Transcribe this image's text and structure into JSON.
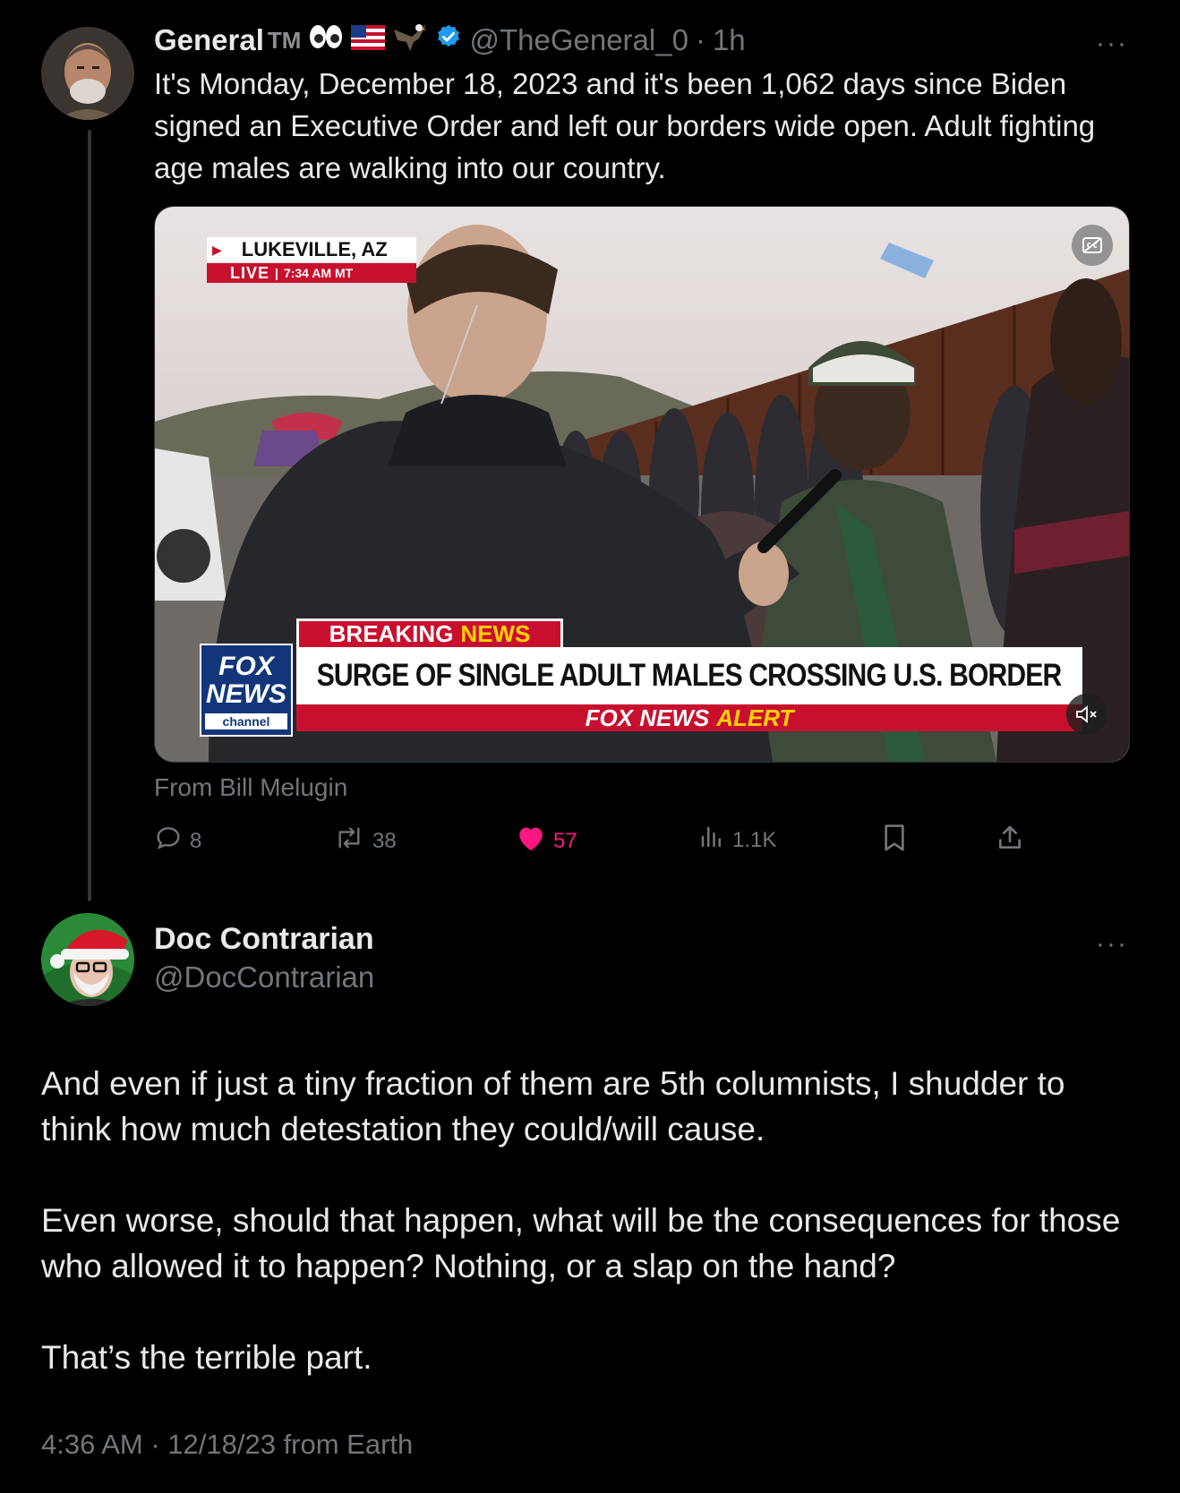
{
  "tweet": {
    "display_name": "General",
    "tm": "TM",
    "handle": "@TheGeneral_0",
    "separator": "·",
    "time": "1h",
    "more_label": "···",
    "text": "It's Monday, December 18, 2023 and it's been 1,062 days since Biden signed an Executive Order and left our borders wide open. Adult fighting age males are walking into our country.",
    "media": {
      "location": "LUKEVILLE, AZ",
      "live": "LIVE",
      "live_time": "7:34 AM MT",
      "breaking": "BREAKING",
      "breaking_news": "NEWS",
      "headline": "SURGE OF SINGLE ADULT MALES CROSSING U.S. BORDER",
      "alert_brand": "FOX NEWS",
      "alert_word": "ALERT",
      "logo_line1": "FOX",
      "logo_line2": "NEWS",
      "logo_line3": "channel",
      "cc_icon": "captions-icon",
      "mute_icon": "mute-icon"
    },
    "from_label": "From Bill Melugin",
    "stats": {
      "replies": "8",
      "reposts": "38",
      "likes": "57",
      "views": "1.1K"
    },
    "like_color": "#f91880"
  },
  "reply": {
    "display_name": "Doc Contrarian",
    "handle": "@DocContrarian",
    "more_label": "···",
    "paragraphs": [
      "And even if just a tiny fraction of them are 5th columnists, I shudder to think how much detestation they could/will cause.",
      "Even worse, should that happen, what will be the consequences for those who allowed it to happen? Nothing, or a slap on the hand?",
      "That’s the terrible part."
    ],
    "meta": "4:36 AM · 12/18/23 from Earth"
  },
  "colors": {
    "background": "#000000",
    "text": "#e7e9ea",
    "muted": "#71767b",
    "verified": "#1d9bf0",
    "fox_red": "#c8102e",
    "fox_blue": "#13357a"
  }
}
